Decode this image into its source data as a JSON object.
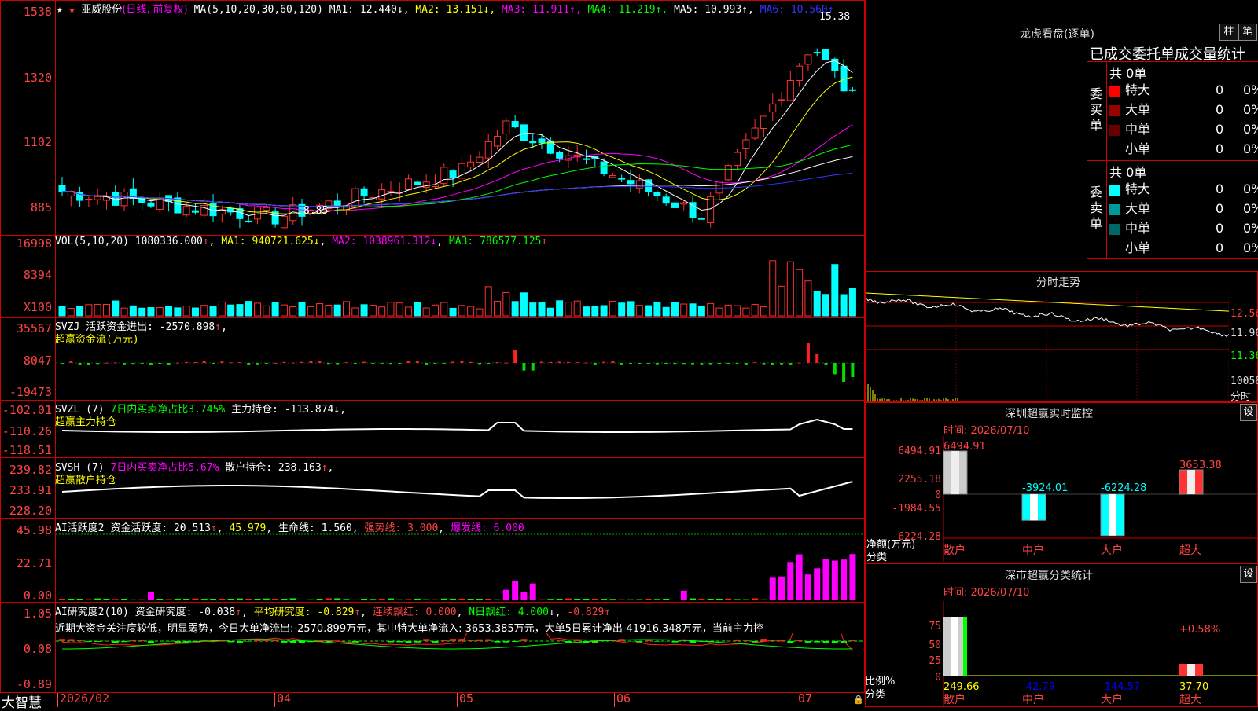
{
  "stock": {
    "name": "亚威股份",
    "mode": "(日线, 前复权)",
    "star": "★"
  },
  "main_header": {
    "ma_def": "MA(5,10,20,30,60,120)",
    "ma": [
      {
        "label": "MA1:",
        "value": "12.440",
        "arrow": "↓",
        "color": "#ffffff"
      },
      {
        "label": "MA2:",
        "value": "13.151",
        "arrow": "↓",
        "color": "#ffff00"
      },
      {
        "label": "MA3:",
        "value": "11.911",
        "arrow": "↑",
        "color": "#ff00ff"
      },
      {
        "label": "MA4:",
        "value": "11.219",
        "arrow": "↑",
        "color": "#00ff00"
      },
      {
        "label": "MA5:",
        "value": "10.993",
        "arrow": "↑",
        "color": "#ffffff"
      },
      {
        "label": "MA6:",
        "value": "10.560",
        "arrow": "↑",
        "color": "#3333ff"
      }
    ]
  },
  "price_axis": [
    "1538",
    "1320",
    "1102",
    "885"
  ],
  "price_marks": {
    "high": "15.38",
    "low": "8.85"
  },
  "vol_header": {
    "name": "VOL(5,10,20)",
    "value": "1080336.000",
    "ma1": "940721.625",
    "ma2": "1038961.312",
    "ma3": "786577.125"
  },
  "vol_axis": [
    "16998",
    "8394",
    "X100"
  ],
  "svzj": {
    "name": "SVZJ",
    "label": "活跃资金进出:",
    "value": "-2570.898",
    "sub": "超赢资金流(万元)",
    "axis": [
      "35567",
      "8047",
      "-19473"
    ]
  },
  "svzl": {
    "name": "SVZL (7)",
    "label1": "7日内买卖净占比3.745%",
    "label2": "主力持仓:",
    "value": "-113.874",
    "sub": "超赢主力持仓",
    "axis": [
      "-102.01",
      "-110.26",
      "-118.51"
    ]
  },
  "svsh": {
    "name": "SVSH (7)",
    "label1": "7日内买卖净占比5.67%",
    "label2": "散户持仓:",
    "value": "238.163",
    "sub": "超赢散户持仓",
    "axis": [
      "239.82",
      "233.91",
      "228.20"
    ]
  },
  "ai_active": {
    "name": "AI活跃度2",
    "label": "资金活跃度:",
    "value": "20.513",
    "v2": "45.979",
    "life": "生命线: 1.560",
    "strong": "强势线: 3.000",
    "burst": "爆发线: 6.000",
    "axis": [
      "45.98",
      "22.71",
      "0.00"
    ]
  },
  "ai_research": {
    "name": "AI研究度2(10)",
    "label": "资金研究度:",
    "value": "-0.038",
    "avg": "平均研究度: -0.829",
    "cont": "连续飘红: 0.000",
    "n": "N日飘红: 4.000",
    "last": "-0.829",
    "note": "近期大资金关注度较低，明显弱势，今日大单净流出:-2570.899万元，其中特大单净流入: 3653.385万元，大单5日累计净出-41916.348万元，当前主力控",
    "axis": [
      "1.05",
      "0.08",
      "-0.89"
    ]
  },
  "date_axis": [
    "2026/02",
    "04",
    "05",
    "06",
    "07"
  ],
  "brand": "大智慧",
  "lhb": {
    "title": "龙虎看盘(逐单)",
    "btn1": "柱",
    "btn2": "笔",
    "subtitle": "已成交委托单成交量统计",
    "buy": {
      "side": "委买单",
      "total": "共 0单",
      "rows": [
        {
          "label": "特大",
          "v": "0",
          "p": "0%",
          "c": "#ff0000"
        },
        {
          "label": "大单",
          "v": "0",
          "p": "0%",
          "c": "#990000"
        },
        {
          "label": "中单",
          "v": "0",
          "p": "0%",
          "c": "#660000"
        },
        {
          "label": "小单",
          "v": "0",
          "p": "0%",
          "c": "#000000"
        }
      ]
    },
    "sell": {
      "side": "委卖单",
      "total": "共 0单",
      "rows": [
        {
          "label": "特大",
          "v": "0",
          "p": "0%",
          "c": "#00ffff"
        },
        {
          "label": "大单",
          "v": "0",
          "p": "0%",
          "c": "#009999"
        },
        {
          "label": "中单",
          "v": "0",
          "p": "0%",
          "c": "#006666"
        },
        {
          "label": "小单",
          "v": "0",
          "p": "0%",
          "c": "#000000"
        }
      ]
    }
  },
  "intraday": {
    "title": "分时走势",
    "axis": [
      "12.56",
      "11.96",
      "11.36"
    ],
    "vol_label": "10058",
    "unit": "分时"
  },
  "sz_monitor": {
    "title": "深圳超赢实时监控",
    "btn": "设",
    "time": "时间: 2026/07/10",
    "axis": [
      "6494.91",
      "2255.18",
      "0",
      "-1984.55",
      "-6224.28"
    ],
    "ylabel": "净额(万元)",
    "xlabel": "分类",
    "chart_data": {
      "type": "bar",
      "categories": [
        "散户",
        "中户",
        "大户",
        "超大"
      ],
      "values": [
        6494.91,
        -3924.01,
        -6224.28,
        3653.38
      ],
      "ylim": [
        -6224.28,
        6494.91
      ]
    }
  },
  "sz_class": {
    "title": "深市超赢分类统计",
    "btn": "设",
    "time": "时间: 2026/07/10",
    "axis": [
      "75",
      "50",
      "25",
      "0"
    ],
    "ylabel": "比例%",
    "xlabel": "分类",
    "chart_data": {
      "type": "bar",
      "categories": [
        "散户",
        "中户",
        "大户",
        "超大"
      ],
      "values": [
        249.66,
        -42.79,
        -144.57,
        37.7
      ],
      "top_label": "+0.58%"
    }
  }
}
